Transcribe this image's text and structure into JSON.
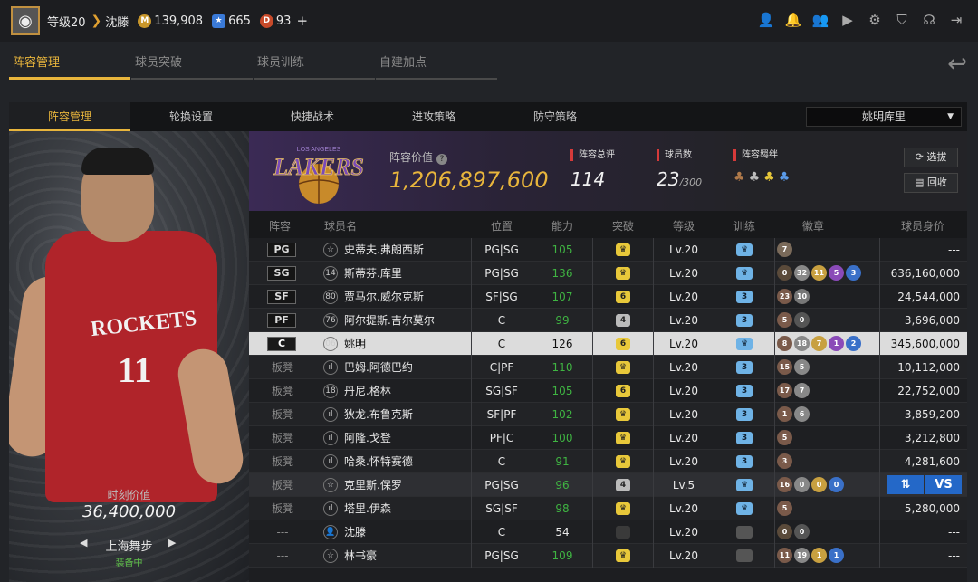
{
  "topbar": {
    "level": "等级20",
    "player_name": "沈滕",
    "gold": "139,908",
    "stars": "665",
    "diamonds": "93",
    "plus": "+",
    "icons": [
      "user-icon",
      "bell-icon",
      "friends-icon",
      "video-icon",
      "gear-icon",
      "shield-icon",
      "headset-icon",
      "exit-icon"
    ]
  },
  "main_tabs": [
    "阵容管理",
    "球员突破",
    "球员训练",
    "自建加点"
  ],
  "sub_tabs": [
    "阵容管理",
    "轮换设置",
    "快捷战术",
    "进攻策略",
    "防守策略"
  ],
  "dropdown": {
    "selected": "姚明库里"
  },
  "player_card": {
    "value_label": "时刻价值",
    "value": "36,400,000",
    "arena": "上海舞步",
    "equip_status": "装备中",
    "jersey_team": "ROCKETS",
    "jersey_num": "11"
  },
  "team": {
    "logo_text": "LAKERS",
    "logo_subtext": "LOS ANGELES",
    "value_label": "阵容价值",
    "value": "1,206,897,600",
    "total_label": "阵容总评",
    "total": "114",
    "count_label": "球员数",
    "count": "23",
    "count_max": "/300",
    "bond_label": "阵容羁绊",
    "btn_select": "选拔",
    "btn_recycle": "回收"
  },
  "table": {
    "headers": [
      "阵容",
      "球员名",
      "位置",
      "能力",
      "突破",
      "等级",
      "训练",
      "徽章",
      "球员身价"
    ],
    "rows": [
      {
        "slot": "PG",
        "num": "☆",
        "name": "史蒂夫.弗朗西斯",
        "pos": "PG|SG",
        "ability": "105",
        "brk": "♛",
        "level": "Lv.20",
        "train": "♛",
        "badges": [
          [
            "7",
            "#7a6a5a"
          ]
        ],
        "price": "---"
      },
      {
        "slot": "SG",
        "num": "14",
        "name": "斯蒂芬.库里",
        "pos": "PG|SG",
        "ability": "136",
        "brk": "♛",
        "level": "Lv.20",
        "train": "♛",
        "badges": [
          [
            "0",
            "#5a4a3a"
          ],
          [
            "32",
            "#888"
          ],
          [
            "11",
            "#c8a040"
          ],
          [
            "5",
            "#8a4ab8"
          ],
          [
            "3",
            "#3a70c8"
          ]
        ],
        "price": "636,160,000"
      },
      {
        "slot": "SF",
        "num": "80",
        "name": "贾马尔.威尔克斯",
        "pos": "SF|SG",
        "ability": "107",
        "brk": "6",
        "level": "Lv.20",
        "train": "3",
        "badges": [
          [
            "23",
            "#7a5a4a"
          ],
          [
            "10",
            "#777"
          ]
        ],
        "price": "24,544,000"
      },
      {
        "slot": "PF",
        "num": "76",
        "name": "阿尔提斯.吉尔莫尔",
        "pos": "C",
        "ability": "99",
        "brk": "4",
        "level": "Lv.20",
        "train": "3",
        "badges": [
          [
            "5",
            "#7a5a4a"
          ],
          [
            "0",
            "#555"
          ]
        ],
        "price": "3,696,000"
      },
      {
        "slot": "C",
        "num": "06",
        "name": "姚明",
        "pos": "C",
        "ability": "126",
        "brk": "6",
        "level": "Lv.20",
        "train": "♛",
        "badges": [
          [
            "8",
            "#7a5a4a"
          ],
          [
            "18",
            "#888"
          ],
          [
            "7",
            "#c8a040"
          ],
          [
            "1",
            "#8a4ab8"
          ],
          [
            "2",
            "#3a70c8"
          ]
        ],
        "price": "345,600,000",
        "selected": true
      },
      {
        "slot": "板凳",
        "num": "ıl",
        "name": "巴姆.阿德巴约",
        "pos": "C|PF",
        "ability": "110",
        "brk": "♛",
        "level": "Lv.20",
        "train": "3",
        "badges": [
          [
            "15",
            "#7a5a4a"
          ],
          [
            "5",
            "#888"
          ]
        ],
        "price": "10,112,000"
      },
      {
        "slot": "板凳",
        "num": "18",
        "name": "丹尼.格林",
        "pos": "SG|SF",
        "ability": "105",
        "brk": "6",
        "level": "Lv.20",
        "train": "3",
        "badges": [
          [
            "17",
            "#7a5a4a"
          ],
          [
            "7",
            "#888"
          ]
        ],
        "price": "22,752,000"
      },
      {
        "slot": "板凳",
        "num": "ıl",
        "name": "狄龙.布鲁克斯",
        "pos": "SF|PF",
        "ability": "102",
        "brk": "♛",
        "level": "Lv.20",
        "train": "3",
        "badges": [
          [
            "1",
            "#7a5a4a"
          ],
          [
            "6",
            "#888"
          ]
        ],
        "price": "3,859,200"
      },
      {
        "slot": "板凳",
        "num": "ıl",
        "name": "阿隆.戈登",
        "pos": "PF|C",
        "ability": "100",
        "brk": "♛",
        "level": "Lv.20",
        "train": "3",
        "badges": [
          [
            "5",
            "#7a5a4a"
          ]
        ],
        "price": "3,212,800"
      },
      {
        "slot": "板凳",
        "num": "ıl",
        "name": "哈桑.怀特赛德",
        "pos": "C",
        "ability": "91",
        "brk": "♛",
        "level": "Lv.20",
        "train": "3",
        "badges": [
          [
            "3",
            "#7a5a4a"
          ]
        ],
        "price": "4,281,600"
      },
      {
        "slot": "板凳",
        "num": "☆",
        "name": "克里斯.保罗",
        "pos": "PG|SG",
        "ability": "96",
        "brk": "4",
        "level": "Lv.5",
        "train": "♛",
        "badges": [
          [
            "16",
            "#7a5a4a"
          ],
          [
            "0",
            "#888"
          ],
          [
            "0",
            "#c8a040"
          ],
          [
            "0",
            "#3a70c8"
          ]
        ],
        "price": "",
        "dim": true,
        "vs": true
      },
      {
        "slot": "板凳",
        "num": "ıl",
        "name": "塔里.伊森",
        "pos": "SG|SF",
        "ability": "98",
        "brk": "♛",
        "level": "Lv.20",
        "train": "♛",
        "badges": [
          [
            "5",
            "#7a5a4a"
          ]
        ],
        "price": "5,280,000"
      },
      {
        "slot": "---",
        "num": "👤",
        "name": "沈滕",
        "pos": "C",
        "ability": "54",
        "brk": "",
        "level": "Lv.20",
        "train": "",
        "badges": [
          [
            "0",
            "#5a4a3a"
          ],
          [
            "0",
            "#555"
          ]
        ],
        "price": "---",
        "white": true
      },
      {
        "slot": "---",
        "num": "☆",
        "name": "林书豪",
        "pos": "PG|SG",
        "ability": "109",
        "brk": "♛",
        "level": "Lv.20",
        "train": "",
        "badges": [
          [
            "11",
            "#7a5a4a"
          ],
          [
            "19",
            "#888"
          ],
          [
            "1",
            "#c8a040"
          ],
          [
            "1",
            "#3a70c8"
          ]
        ],
        "price": "---"
      }
    ]
  },
  "vs": {
    "swap": "⇅",
    "vs": "VS"
  }
}
